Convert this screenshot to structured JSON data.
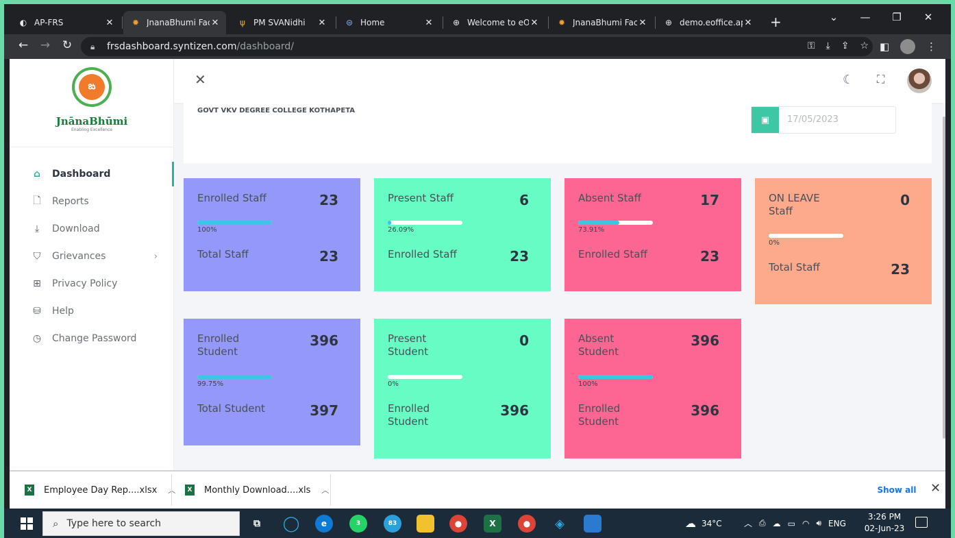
{
  "browser": {
    "tabs": [
      {
        "label": "AP-FRS",
        "icon": "◐",
        "active": false
      },
      {
        "label": "JnanaBhumi Facial",
        "icon": "✹",
        "active": true
      },
      {
        "label": "PM SVANidhi",
        "icon": "ψ",
        "active": false
      },
      {
        "label": "Home",
        "icon": "⊜",
        "active": false
      },
      {
        "label": "Welcome to eOffi",
        "icon": "⊕",
        "active": false
      },
      {
        "label": "JnanaBhumi Facial",
        "icon": "✹",
        "active": false
      },
      {
        "label": "demo.eoffice.ap.g",
        "icon": "⊕",
        "active": false
      }
    ],
    "url_host": "frsdashboard.syntizen.com",
    "url_path": "/dashboard/"
  },
  "sidebar": {
    "brand_name": "JnānaBhūmi",
    "brand_tagline": "Enabling Excellence",
    "items": [
      {
        "label": "Dashboard",
        "icon": "⌂",
        "active": true
      },
      {
        "label": "Reports",
        "icon": "🗋"
      },
      {
        "label": "Download",
        "icon": "⤓"
      },
      {
        "label": "Grievances",
        "icon": "⛉",
        "chevron": "›"
      },
      {
        "label": "Privacy Policy",
        "icon": "⊞"
      },
      {
        "label": "Help",
        "icon": "⛁"
      },
      {
        "label": "Change Password",
        "icon": "◷"
      }
    ]
  },
  "main": {
    "college": "GOVT VKV DEGREE COLLEGE KOTHAPETA",
    "date": "17/05/2023",
    "staff_cards": [
      {
        "label": "Enrolled Staff",
        "value": "23",
        "percent": "100%",
        "fill": 100,
        "sub_label": "Total Staff",
        "sub_value": "23",
        "color": "#9499f9"
      },
      {
        "label": "Present Staff",
        "value": "6",
        "percent": "26.09%",
        "fill": 5,
        "sub_label": "Enrolled Staff",
        "sub_value": "23",
        "color": "#66fcc3"
      },
      {
        "label": "Absent Staff",
        "value": "17",
        "percent": "73.91%",
        "fill": 55,
        "sub_label": "Enrolled Staff",
        "sub_value": "23",
        "color": "#fd6693"
      },
      {
        "label": "ON LEAVE Staff",
        "value": "0",
        "percent": "0%",
        "fill": 0,
        "sub_label": "Total Staff",
        "sub_value": "23",
        "color": "#fda98c"
      }
    ],
    "student_cards": [
      {
        "label": "Enrolled Student",
        "value": "396",
        "percent": "99.75%",
        "fill": 99.75,
        "sub_label": "Total Student",
        "sub_value": "397",
        "color": "#9499f9"
      },
      {
        "label": "Present Student",
        "value": "0",
        "percent": "0%",
        "fill": 0,
        "sub_label": "Enrolled Student",
        "sub_value": "396",
        "color": "#66fcc3"
      },
      {
        "label": "Absent Student",
        "value": "396",
        "percent": "100%",
        "fill": 100,
        "sub_label": "Enrolled Student",
        "sub_value": "396",
        "color": "#fd6693"
      }
    ]
  },
  "downloads": {
    "items": [
      "Employee Day Rep....xlsx",
      "Monthly Download....xls"
    ],
    "show_all": "Show all"
  },
  "taskbar": {
    "search_placeholder": "Type here to search",
    "weather": "34°C",
    "language": "ENG",
    "time": "3:26 PM",
    "date": "02-Jun-23",
    "whatsapp_badge": "3",
    "telegram_badge": "83"
  }
}
